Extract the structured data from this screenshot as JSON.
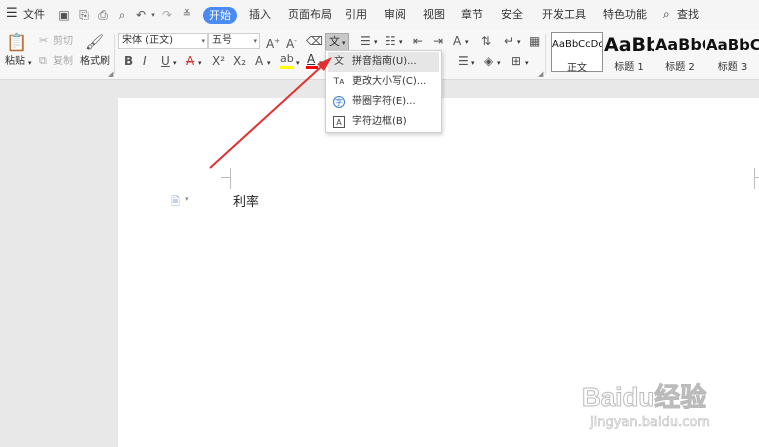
{
  "menubar": {
    "file": "文件",
    "tabs": [
      "开始",
      "插入",
      "页面布局",
      "引用",
      "审阅",
      "视图",
      "章节",
      "安全",
      "开发工具",
      "特色功能"
    ],
    "search": "查找"
  },
  "ribbon": {
    "paste": "粘贴",
    "cut": "剪切",
    "copy": "复制",
    "format_painter": "格式刷",
    "font_name": "宋体 (正文)",
    "font_size": "五号",
    "styles": [
      {
        "sample": "AaBbCcDd",
        "label": "正文"
      },
      {
        "sample": "AaBb",
        "label": "标题 1"
      },
      {
        "sample": "AaBbC",
        "label": "标题 2"
      },
      {
        "sample": "AaBbC",
        "label": "标题 3"
      }
    ]
  },
  "dropdown": {
    "items": [
      "拼音指南(U)...",
      "更改大小写(C)...",
      "带圈字符(E)...",
      "字符边框(B)"
    ]
  },
  "document": {
    "text": "利率"
  },
  "watermark": {
    "brand": "Baidu经验",
    "url": "jingyan.baidu.com"
  },
  "colors": {
    "accent": "#4a8af4",
    "annotation_arrow": "#e03030",
    "font_color_bar": "#ff0000",
    "highlight_bar": "#ffff00"
  }
}
